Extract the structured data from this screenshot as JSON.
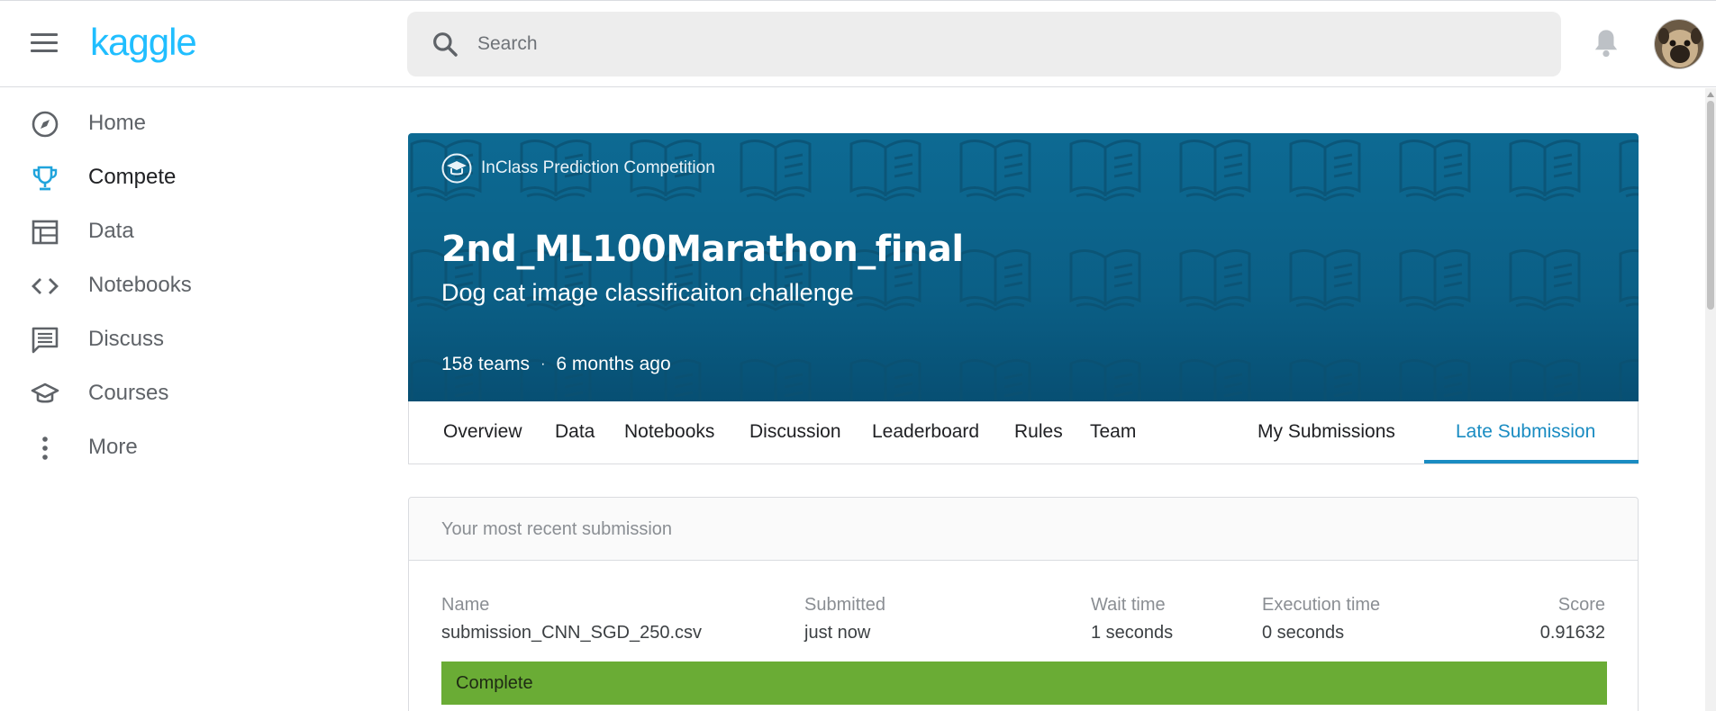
{
  "header": {
    "logo": "kaggle",
    "search_placeholder": "Search"
  },
  "sidebar": {
    "items": [
      {
        "label": "Home",
        "icon": "compass-icon"
      },
      {
        "label": "Compete",
        "icon": "trophy-icon",
        "active": true
      },
      {
        "label": "Data",
        "icon": "table-icon"
      },
      {
        "label": "Notebooks",
        "icon": "code-icon"
      },
      {
        "label": "Discuss",
        "icon": "comment-icon"
      },
      {
        "label": "Courses",
        "icon": "graduation-cap-icon"
      },
      {
        "label": "More",
        "icon": "more-vert-icon"
      }
    ]
  },
  "competition": {
    "type": "InClass Prediction Competition",
    "title": "2nd_ML100Marathon_final",
    "subtitle": "Dog cat image classificaiton challenge",
    "teams": "158 teams",
    "separator": "·",
    "ago": "6 months ago"
  },
  "tabs": [
    {
      "label": "Overview"
    },
    {
      "label": "Data"
    },
    {
      "label": "Notebooks"
    },
    {
      "label": "Discussion"
    },
    {
      "label": "Leaderboard"
    },
    {
      "label": "Rules"
    },
    {
      "label": "Team"
    },
    {
      "label": "My Submissions"
    },
    {
      "label": "Late Submission",
      "active": true
    }
  ],
  "submission": {
    "header": "Your most recent submission",
    "columns": {
      "name": {
        "label": "Name",
        "value": "submission_CNN_SGD_250.csv"
      },
      "submitted": {
        "label": "Submitted",
        "value": "just now"
      },
      "wait": {
        "label": "Wait time",
        "value": "1 seconds"
      },
      "execution": {
        "label": "Execution time",
        "value": "0 seconds"
      },
      "score": {
        "label": "Score",
        "value": "0.91632"
      }
    },
    "status": "Complete"
  },
  "colors": {
    "brand": "#20beff",
    "accent": "#1a8cc2",
    "complete": "#6aac35",
    "banner": "#0b5f86"
  }
}
